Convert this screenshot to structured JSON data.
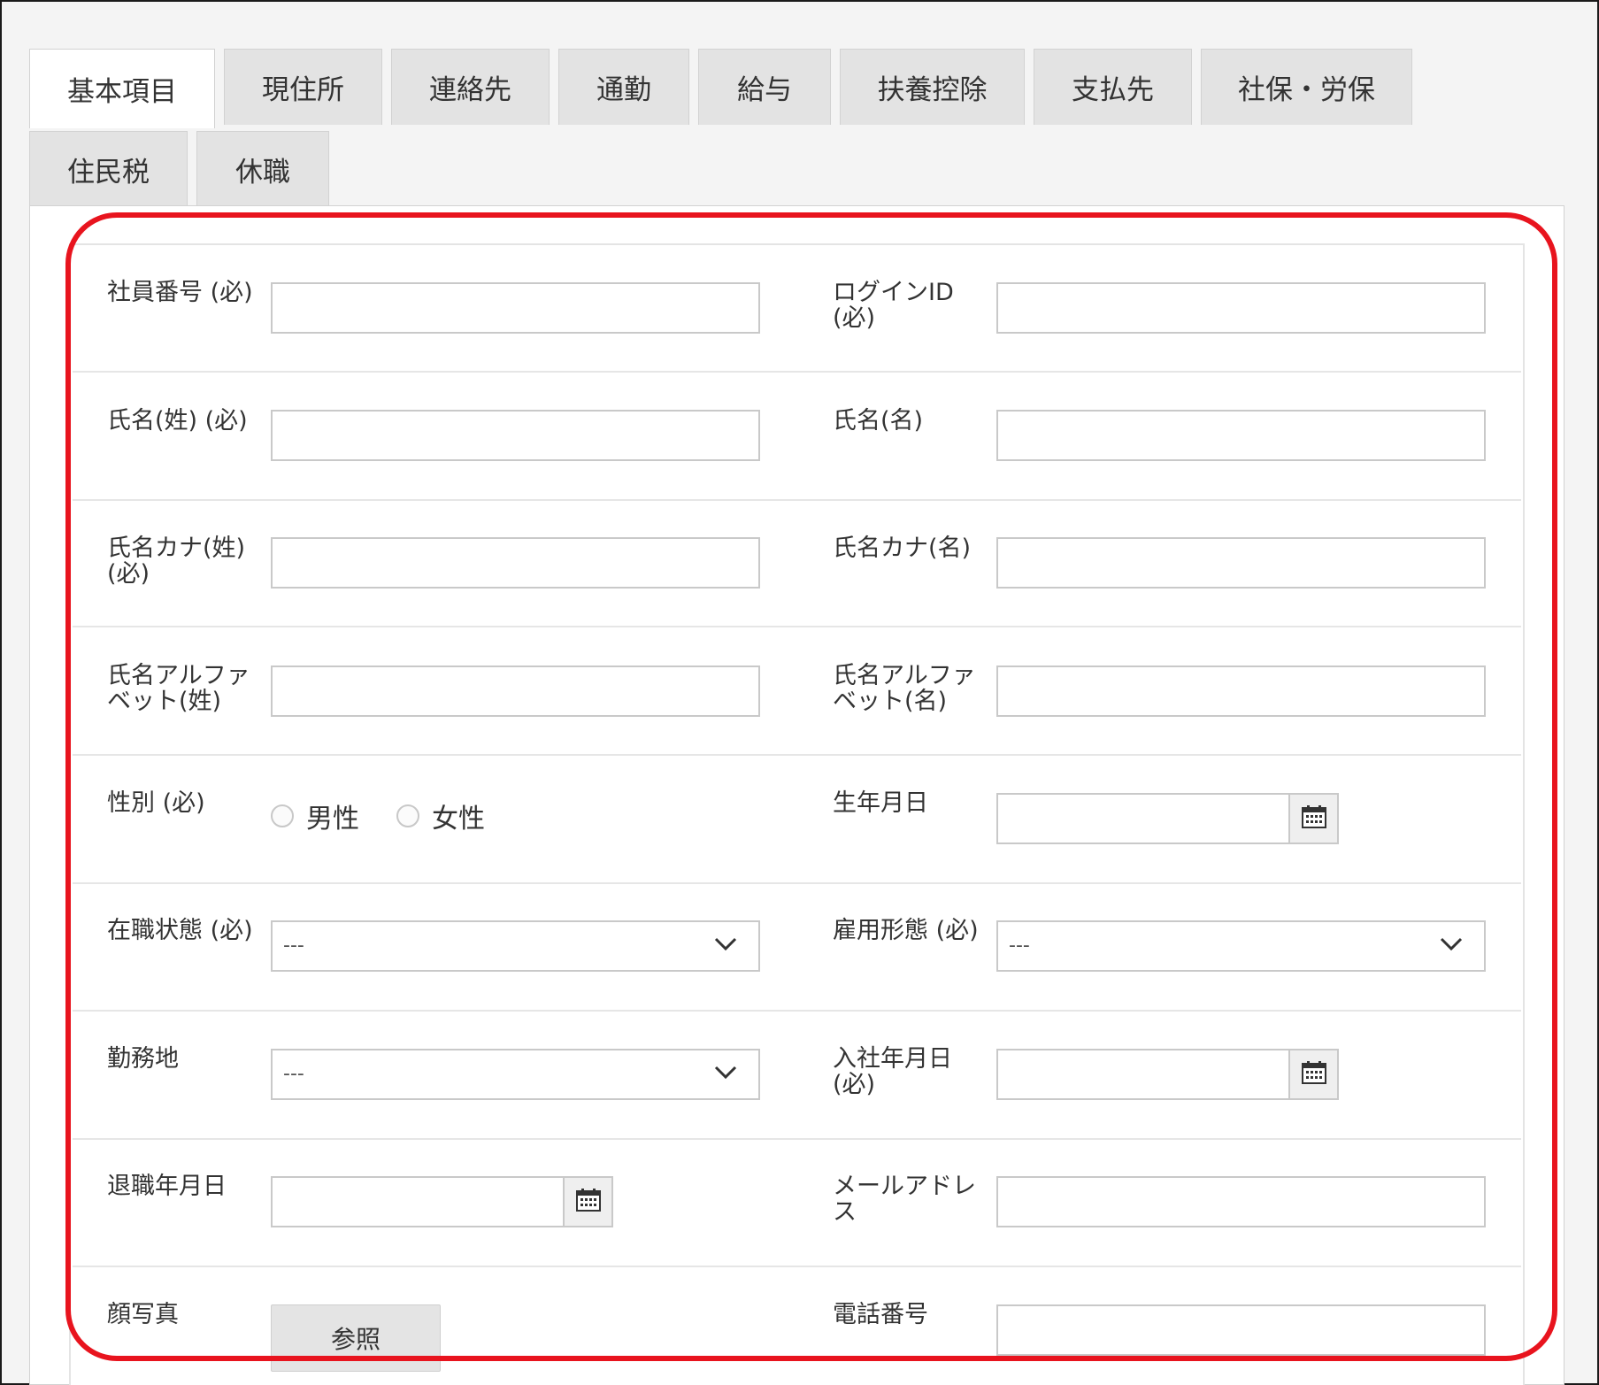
{
  "tabs": [
    {
      "label": "基本項目",
      "active": true
    },
    {
      "label": "現住所"
    },
    {
      "label": "連絡先"
    },
    {
      "label": "通勤"
    },
    {
      "label": "給与"
    },
    {
      "label": "扶養控除"
    },
    {
      "label": "支払先"
    },
    {
      "label": "社保・労保"
    },
    {
      "label": "住民税"
    },
    {
      "label": "休職"
    }
  ],
  "form": {
    "employee_id": {
      "label": "社員番号 (必)",
      "value": ""
    },
    "login_id": {
      "label": "ログインID\n(必)",
      "value": ""
    },
    "last_name": {
      "label": "氏名(姓) (必)",
      "value": ""
    },
    "first_name": {
      "label": "氏名(名)",
      "value": ""
    },
    "last_name_kana": {
      "label": "氏名カナ(姓)\n(必)",
      "value": ""
    },
    "first_name_kana": {
      "label": "氏名カナ(名)",
      "value": ""
    },
    "last_name_alpha": {
      "label": "氏名アルファ\nベット(姓)",
      "value": ""
    },
    "first_name_alpha": {
      "label": "氏名アルファ\nベット(名)",
      "value": ""
    },
    "gender": {
      "label": "性別 (必)",
      "options": [
        "男性",
        "女性"
      ],
      "selected": ""
    },
    "birthdate": {
      "label": "生年月日",
      "value": ""
    },
    "employment_status": {
      "label": "在職状態 (必)",
      "value": "---"
    },
    "employment_type": {
      "label": "雇用形態 (必)",
      "value": "---"
    },
    "work_location": {
      "label": "勤務地",
      "value": "---"
    },
    "hire_date": {
      "label": "入社年月日\n(必)",
      "value": ""
    },
    "retirement_date": {
      "label": "退職年月日",
      "value": ""
    },
    "email": {
      "label": "メールアドレ\nス",
      "value": ""
    },
    "photo": {
      "label": "顔写真",
      "button": "参照"
    },
    "phone": {
      "label": "電話番号",
      "value": ""
    }
  },
  "colors": {
    "highlight": "#e8141e",
    "tab_inactive": "#e3e3e3",
    "tab_active": "#ffffff",
    "input_border": "#c9c9c9"
  }
}
